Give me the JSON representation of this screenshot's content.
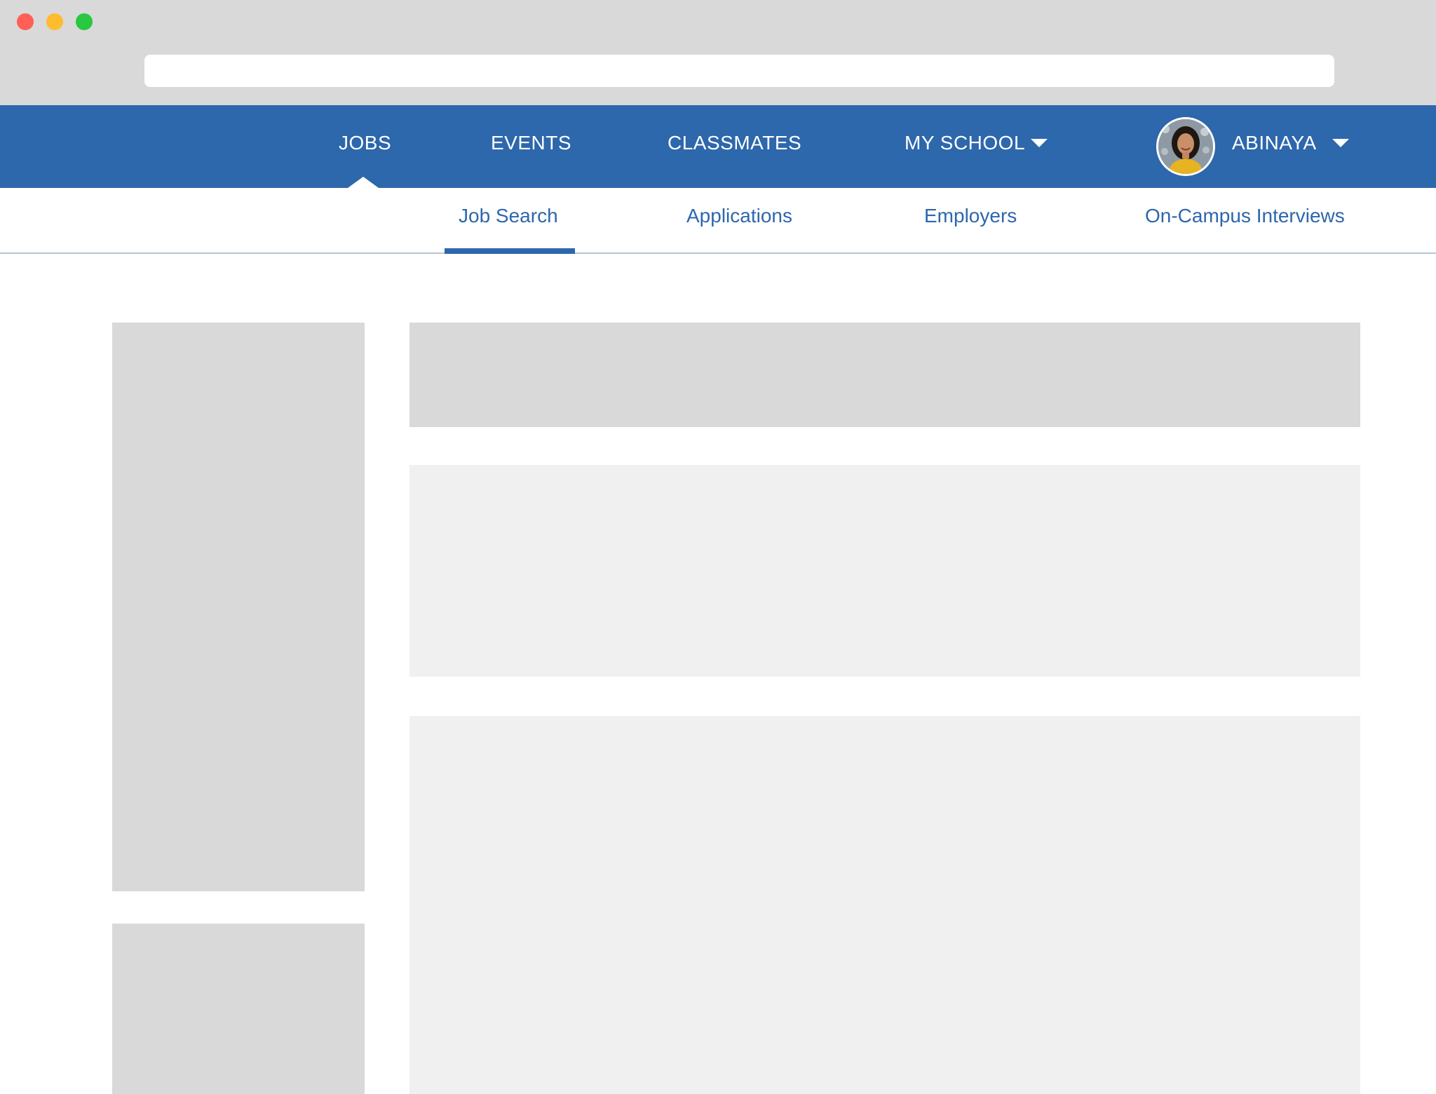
{
  "colors": {
    "chrome_bg": "#d9d9d9",
    "nav_blue": "#2d67ac",
    "link_blue": "#2d67ac",
    "placeholder_dark": "#d9d9d9",
    "placeholder_light": "#f0f0f0",
    "dot_red": "#fe5f57",
    "dot_yellow": "#febc2e",
    "dot_green": "#28c840"
  },
  "window": {
    "controls": [
      "close",
      "minimize",
      "maximize"
    ],
    "address_bar": ""
  },
  "nav": {
    "items": [
      {
        "label": "JOBS",
        "active": true
      },
      {
        "label": "EVENTS"
      },
      {
        "label": "CLASSMATES"
      },
      {
        "label": "MY SCHOOL",
        "dropdown": true
      }
    ],
    "user": {
      "name": "ABINAYA",
      "dropdown": true,
      "avatar": "user-avatar"
    }
  },
  "subnav": {
    "tabs": [
      {
        "label": "Job Search",
        "active": true
      },
      {
        "label": "Applications"
      },
      {
        "label": "Employers"
      },
      {
        "label": "On-Campus Interviews"
      }
    ]
  }
}
